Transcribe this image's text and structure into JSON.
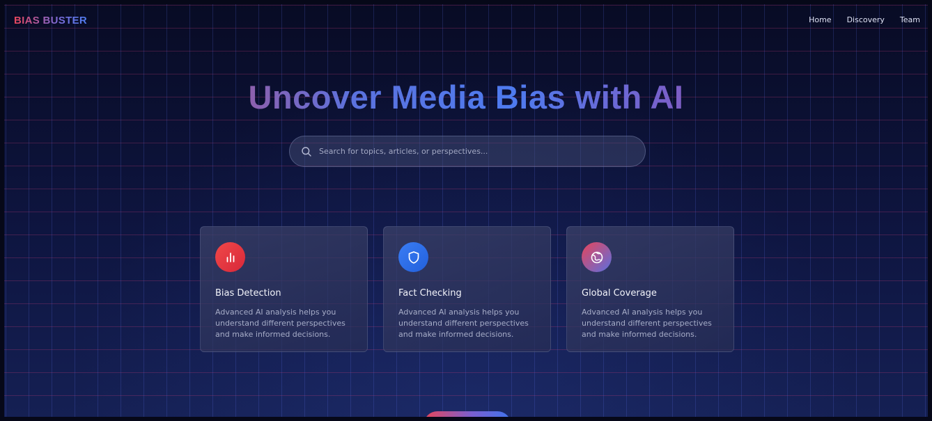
{
  "nav": {
    "brand": "BIAS BUSTER",
    "links": [
      "Home",
      "Discovery",
      "Team"
    ]
  },
  "hero": {
    "title": "Uncover Media Bias with AI"
  },
  "search": {
    "placeholder": "Search for topics, articles, or perspectives..."
  },
  "features": [
    {
      "icon": "bar-chart-icon",
      "title": "Bias Detection",
      "description": "Advanced AI analysis helps you understand different perspectives and make informed decisions."
    },
    {
      "icon": "shield-icon",
      "title": "Fact Checking",
      "description": "Advanced AI analysis helps you understand different perspectives and make informed decisions."
    },
    {
      "icon": "globe-icon",
      "title": "Global Coverage",
      "description": "Advanced AI analysis helps you understand different perspectives and make informed decisions."
    }
  ],
  "colors": {
    "accent_red": "#e8455a",
    "accent_blue": "#4f7df0",
    "background": "#0b1030"
  }
}
